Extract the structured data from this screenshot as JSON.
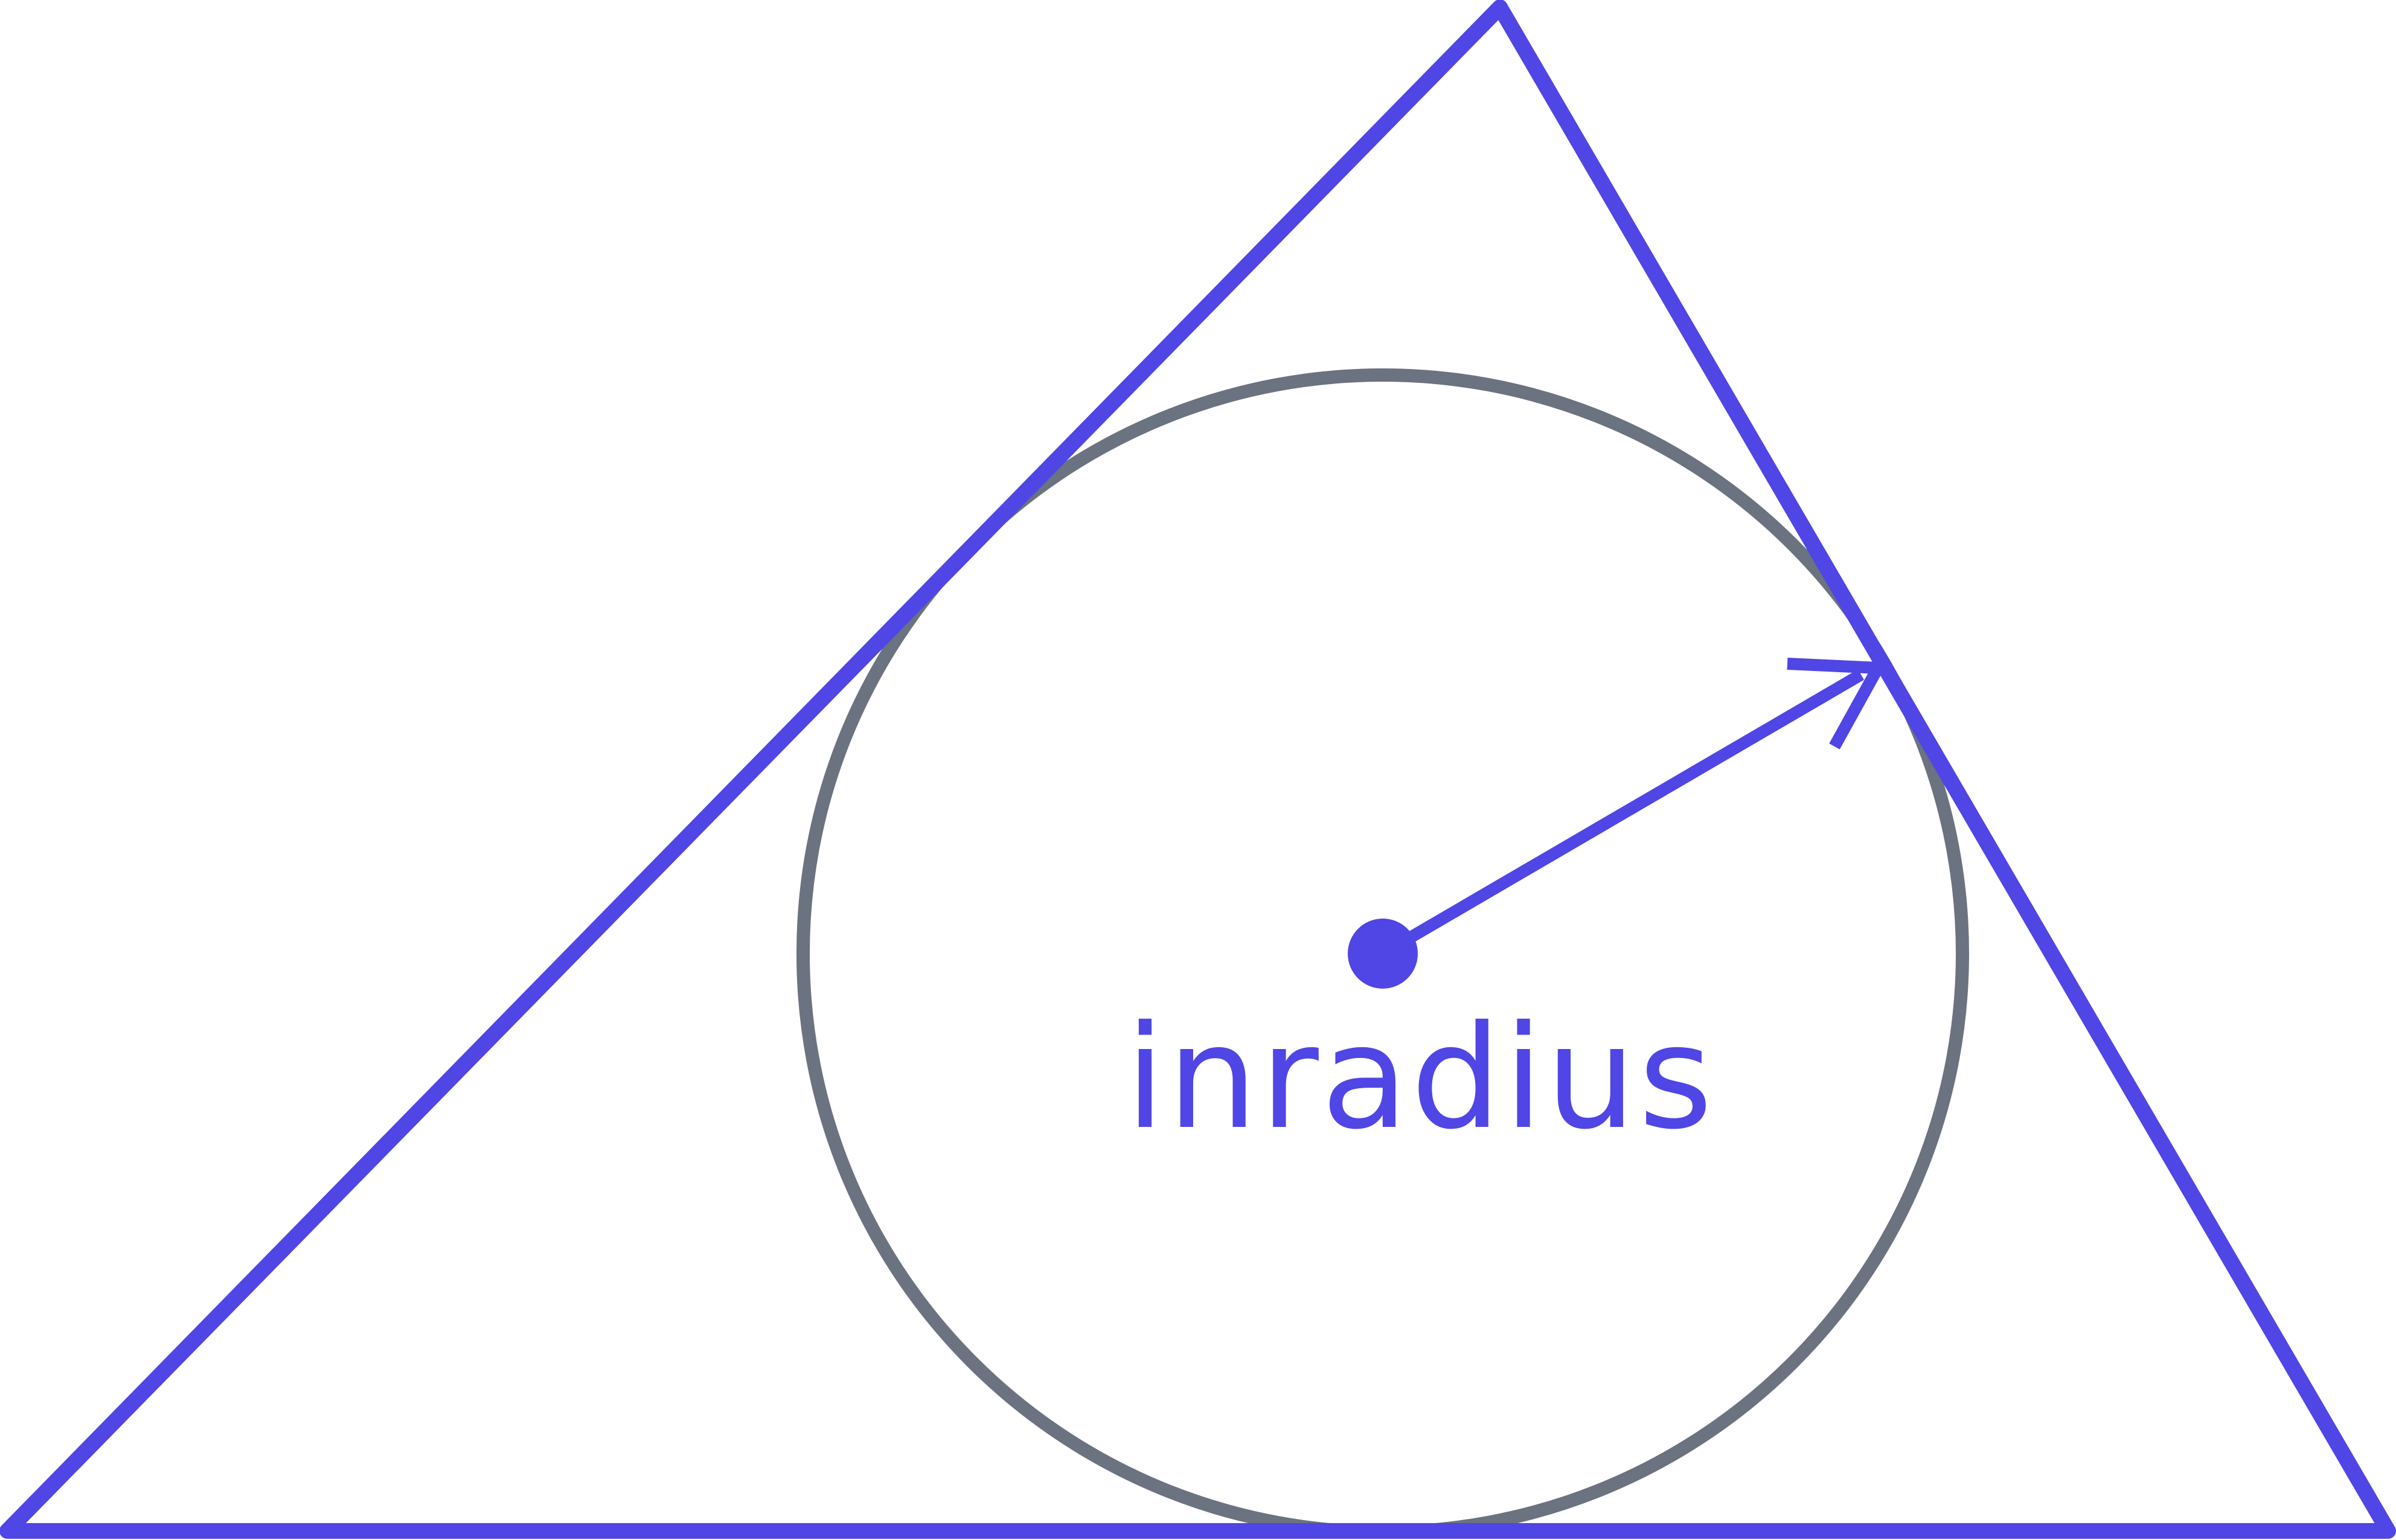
{
  "diagram": {
    "label": "inradius",
    "colors": {
      "triangle": "#4f46e5",
      "circle": "#6b7280",
      "radius": "#4f46e5",
      "center": "#4f46e5",
      "label": "#4f46e5"
    }
  }
}
